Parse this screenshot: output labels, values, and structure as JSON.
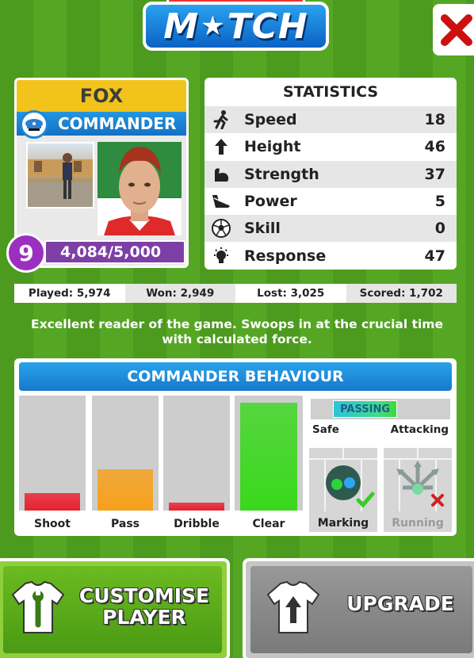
{
  "logo": {
    "word": "MATCH",
    "star": "★"
  },
  "close_icon": "close-x-icon",
  "player": {
    "name": "FOX",
    "role": "COMMANDER",
    "level": "9",
    "xp": "4,084/5,000",
    "xp_progress": 0.8168
  },
  "statistics": {
    "title": "STATISTICS",
    "rows": [
      {
        "icon": "running-man-icon",
        "label": "Speed",
        "value": "18"
      },
      {
        "icon": "up-arrow-icon",
        "label": "Height",
        "value": "46"
      },
      {
        "icon": "flexed-arm-icon",
        "label": "Strength",
        "value": "37"
      },
      {
        "icon": "boot-icon",
        "label": "Power",
        "value": "5"
      },
      {
        "icon": "soccer-ball-icon",
        "label": "Skill",
        "value": "0"
      },
      {
        "icon": "light-bulb-icon",
        "label": "Response",
        "value": "47"
      }
    ]
  },
  "record": {
    "played": "Played: 5,974",
    "won": "Won: 2,949",
    "lost": "Lost: 3,025",
    "scored": "Scored: 1,702"
  },
  "description": "Excellent reader of the game. Swoops in at the crucial time with calculated force.",
  "behaviour": {
    "title": "COMMANDER BEHAVIOUR",
    "bars": [
      {
        "label": "Shoot",
        "level": 0.15,
        "color": "#e8202e"
      },
      {
        "label": "Pass",
        "level": 0.36,
        "color": "#f7a01a"
      },
      {
        "label": "Dribble",
        "level": 0.07,
        "color": "#e8202e"
      },
      {
        "label": "Clear",
        "level": 0.94,
        "color": "#39d81c"
      }
    ],
    "passing": {
      "label": "PASSING",
      "low": "Safe",
      "high": "Attacking",
      "level": 0.62
    },
    "marking": {
      "label": "Marking",
      "status": "enabled"
    },
    "running": {
      "label": "Running",
      "status": "disabled"
    }
  },
  "buttons": {
    "customise_line1": "CUSTOMISE",
    "customise_line2": "PLAYER",
    "upgrade": "UPGRADE"
  }
}
